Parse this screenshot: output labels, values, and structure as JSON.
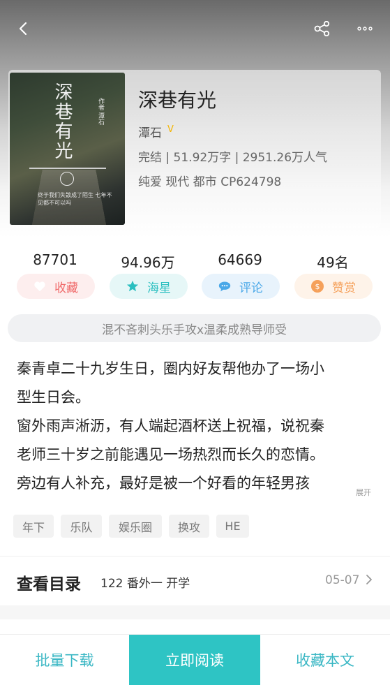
{
  "book": {
    "title": "深巷有光",
    "author": "潭石",
    "vip_mark": "V",
    "meta": "完结 | 51.92万字 | 2951.26万人气",
    "tags_line": "纯爱  现代  都市  CP624798"
  },
  "cover": {
    "title": "深巷有光",
    "author_text": "作者 潭石",
    "caption": "终于我们失散成了陌生 七年不见都不可以吗"
  },
  "stats": [
    {
      "number": "87701",
      "label": "收藏",
      "color": "#f06a6a",
      "bg": "#fdeeee"
    },
    {
      "number": "94.96万",
      "label": "海星",
      "color": "#2bbfc0",
      "bg": "#e6f7f7"
    },
    {
      "number": "64669",
      "label": "评论",
      "color": "#4aa8e8",
      "bg": "#e8f3fc"
    },
    {
      "number": "49名",
      "label": "赞赏",
      "color": "#f5a05a",
      "bg": "#fef3e9"
    }
  ],
  "banner": "混不吝刺头乐手攻x温柔成熟导师受",
  "description": {
    "lines": [
      "秦青卓二十九岁生日，圈内好友帮他办了一场小",
      "型生日会。",
      "窗外雨声淅沥，有人端起酒杯送上祝福，说祝秦",
      "老师三十岁之前能遇见一场热烈而长久的恋情。",
      "旁边有人补充，最好是被一个好看的年轻男孩"
    ],
    "expand_label": "展开"
  },
  "tags": [
    "年下",
    "乐队",
    "娱乐圈",
    "换攻",
    "HE"
  ],
  "toc": {
    "title": "查看目录",
    "latest": "122 番外一 开学",
    "date": "05-07"
  },
  "bottom_bar": {
    "download": "批量下载",
    "read": "立即阅读",
    "collect": "收藏本文"
  },
  "icons": {
    "back": "back-arrow-icon",
    "share": "share-icon",
    "more": "more-dots-icon"
  }
}
